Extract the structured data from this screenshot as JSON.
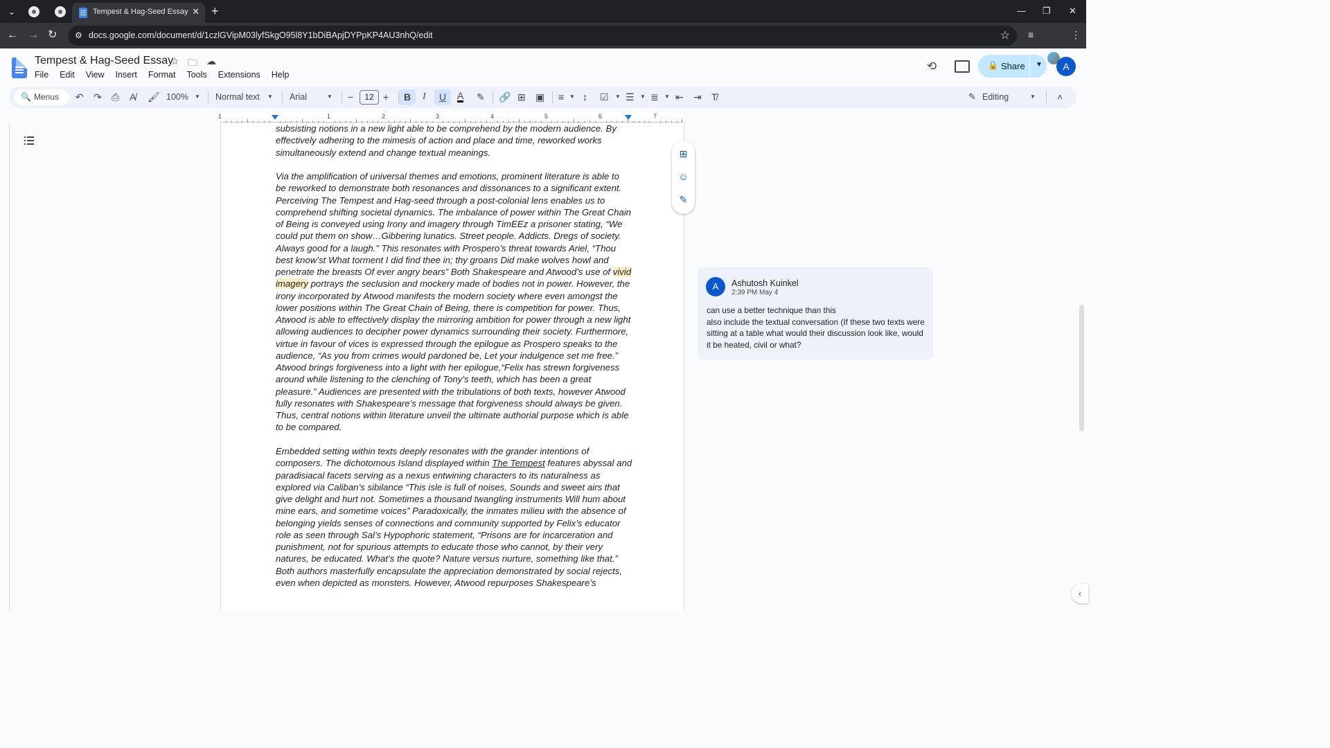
{
  "browser": {
    "tab_title": "Tempest & Hag-Seed Essay - Google Docs",
    "url": "docs.google.com/document/d/1czlGVipM03lyfSkgO95l8Y1bDiBApjDYPpKP4AU3nhQ/edit",
    "new_tab_symbol": "+",
    "tab_close_symbol": "✕"
  },
  "doc": {
    "title": "Tempest & Hag-Seed Essay",
    "menu": [
      "File",
      "Edit",
      "View",
      "Insert",
      "Format",
      "Tools",
      "Extensions",
      "Help"
    ],
    "share_label": "Share",
    "account_initial": "A"
  },
  "toolbar": {
    "menus_label": "Menus",
    "zoom": "100%",
    "style": "Normal text",
    "font": "Arial",
    "font_size": "12",
    "editing_mode": "Editing",
    "icons": [
      "search-icon",
      "undo-icon",
      "redo-icon",
      "print-icon",
      "spellcheck-icon",
      "paint-format-icon",
      "bold-icon",
      "italic-icon",
      "underline-icon",
      "text-color-icon",
      "highlight-icon",
      "link-icon",
      "add-comment-icon",
      "insert-image-icon",
      "align-icon",
      "line-spacing-icon",
      "checklist-icon",
      "bulleted-list-icon",
      "numbered-list-icon",
      "decrease-indent-icon",
      "increase-indent-icon",
      "clear-formatting-icon",
      "pencil-icon"
    ]
  },
  "ruler": {
    "numbers": [
      "1",
      "1",
      "2",
      "3",
      "4",
      "5",
      "6",
      "7"
    ]
  },
  "document": {
    "p1": [
      "subsisting notions in a new light able to be comprehend by the modern audience. By",
      "effectively adhering to the mimesis of action and place and time, reworked works",
      "simultaneously extend and change textual meanings."
    ],
    "p2": [
      "Via the amplification of universal themes and emotions, prominent literature is able to",
      "be reworked to demonstrate both resonances and dissonances to a significant extent.",
      "Perceiving The Tempest and Hag-seed through a post-colonial lens enables us to",
      "comprehend shifting societal dynamics. The imbalance of power within The Great Chain",
      "of Being is conveyed using Irony and imagery through TimEEz a prisoner stating, “We",
      "could put them on show…Gibbering lunatics. Street people. Addicts. Dregs of society.",
      "Always good for a laugh.” This resonates with Prospero’s threat towards Ariel, “Thou",
      "best know’st What torment I did find thee in; thy groans Did make wolves howl and",
      "penetrate the breasts Of ever angry bears” Both Shakespeare and Atwood’s use of ",
      "vivid",
      "imagery",
      " portrays the seclusion and mockery made of bodies not in power. However, the",
      "irony incorporated by Atwood manifests the modern society where even amongst the",
      "lower positions within The Great Chain of Being, there is competition for power. Thus,",
      "Atwood is able to effectively display the mirroring ambition for power through a new light",
      "allowing audiences to decipher power dynamics surrounding their society. Furthermore,",
      "virtue in favour of vices is expressed through the epilogue as Prospero speaks to the",
      "audience, “As you from crimes would pardoned be, Let your indulgence set me free.”",
      "Atwood brings forgiveness into a light with her epilogue,“Felix has strewn forgiveness",
      "around while listening to the clenching of Tony’s teeth, which has been a great",
      "pleasure.” Audiences are presented with the tribulations of both texts, however Atwood",
      "fully resonates with Shakespeare’s message that forgiveness should always be given.",
      "Thus, central notions within literature unveil the ultimate authorial purpose which is able",
      "to be compared."
    ],
    "p3": [
      "Embedded setting within texts deeply resonates with the grander intentions of",
      "composers. The dichotomous Island displayed within ",
      "The Tempest",
      " features abyssal and",
      "paradisiacal facets serving as a nexus entwining characters to its naturalness as",
      "explored via Caliban’s sibilance “This isle is full of noises, Sounds and sweet airs that",
      "give delight and hurt not. Sometimes a thousand twangling instruments Will hum about",
      "mine ears, and sometime voices” Paradoxically, the inmates milieu with the absence of",
      "belonging yields senses of connections and community supported by Felix’s educator",
      "role as seen through Sal’s Hypophoric statement, “Prisons are for incarceration and",
      "punishment, not for spurious attempts to educate those who cannot, by their very",
      "natures, be educated. What’s the quote? Nature versus nurture, something like that.”",
      "Both authors masterfully encapsulate the appreciation demonstrated by social rejects,",
      "even when depicted as monsters. However, Atwood repurposes Shakespeare’s"
    ]
  },
  "comment": {
    "author": "Ashutosh Kuinkel",
    "initial": "A",
    "time": "2:39 PM May 4",
    "line1": "can use a better technique than this",
    "line2": "also include the textual conversation (If these two texts were sitting at a table what would their discussion look like, would it be heated, civil or what?"
  },
  "colors": {
    "accent": "#0b57d0",
    "share_bg": "#c2e7ff",
    "highlight": "#fbeec5"
  }
}
